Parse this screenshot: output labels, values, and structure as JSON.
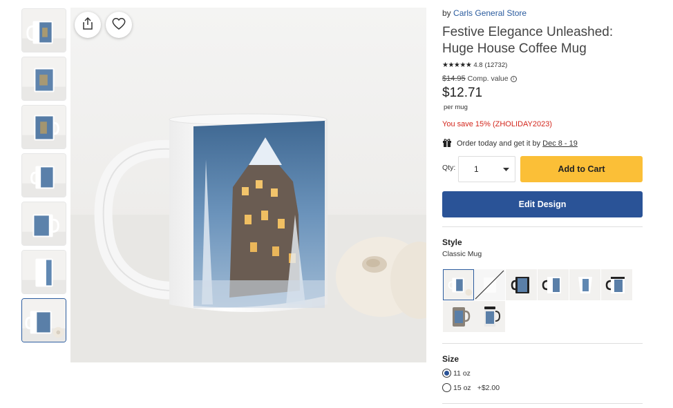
{
  "product": {
    "by_prefix": "by",
    "store": "Carls General Store",
    "title": "Festive Elegance Unleashed: Huge House Coffee Mug",
    "stars": "★★★★★",
    "rating": "4.8",
    "reviews": "(12732)",
    "comp_price": "$14.95",
    "comp_label": "Comp. value",
    "price": "$12.71",
    "per_unit": "per mug",
    "savings": "You save 15% (ZHOLIDAY2023)",
    "delivery_text": "Order today and get it by",
    "delivery_dates": "Dec 8 - 19"
  },
  "purchase": {
    "qty_label": "Qty:",
    "qty_value": "1",
    "add_to_cart": "Add to Cart",
    "edit_design": "Edit Design"
  },
  "style": {
    "heading": "Style",
    "selected": "Classic Mug",
    "options": [
      "Classic Mug",
      "Unavailable style",
      "Two-tone black mug",
      "Black handle mug",
      "Latte mug",
      "Black rim mug",
      "Beer stein",
      "Travel mug"
    ]
  },
  "size": {
    "heading": "Size",
    "options": [
      {
        "label": "11 oz",
        "extra": "",
        "checked": true
      },
      {
        "label": "15 oz",
        "extra": "+$2.00",
        "checked": false
      }
    ]
  },
  "gallery": {
    "thumb_count": 7,
    "selected_thumb": 7
  },
  "colors": {
    "accent_blue": "#2a5397",
    "cart_yellow": "#fbbf37",
    "sale_red": "#d3261c"
  },
  "icons": [
    "share-icon",
    "heart-icon",
    "gift-icon",
    "chevron-down-icon",
    "info-icon"
  ]
}
